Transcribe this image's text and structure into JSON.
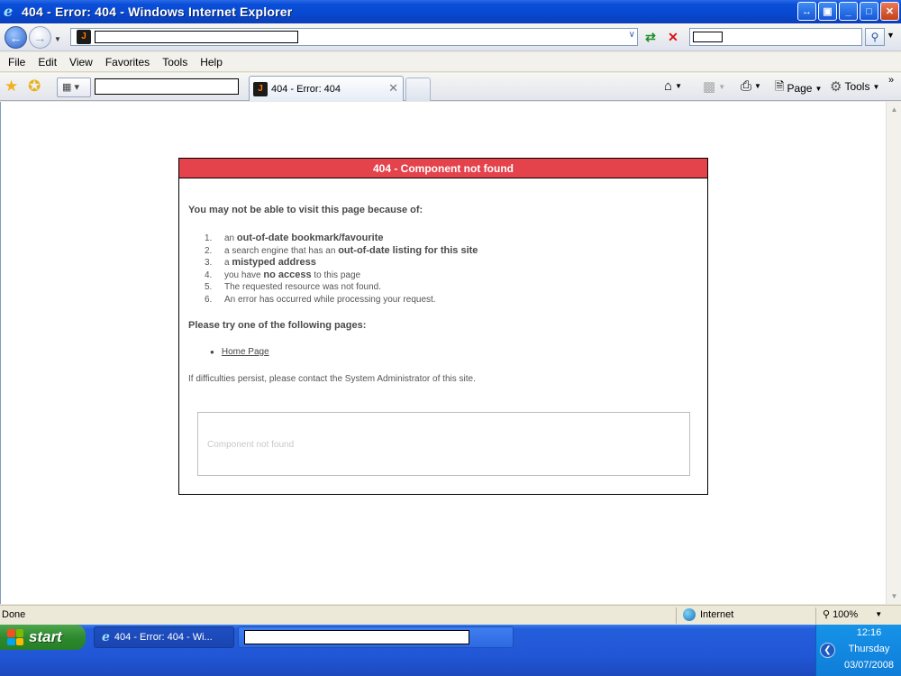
{
  "window": {
    "title": "404 - Error: 404 - Windows Internet Explorer"
  },
  "menu": [
    "File",
    "Edit",
    "View",
    "Favorites",
    "Tools",
    "Help"
  ],
  "tab": {
    "label": "404 - Error: 404"
  },
  "commands": {
    "page": "Page",
    "tools": "Tools"
  },
  "error_page": {
    "header": "404 - Component not found",
    "reasons_title": "You may not be able to visit this page because of:",
    "reasons": [
      {
        "num": "1.",
        "pre": "an ",
        "bold": "out-of-date bookmark/favourite",
        "post": ""
      },
      {
        "num": "2.",
        "pre": "a search engine that has an ",
        "bold": "out-of-date listing for this site",
        "post": ""
      },
      {
        "num": "3.",
        "pre": "a ",
        "bold": "mistyped address",
        "post": ""
      },
      {
        "num": "4.",
        "pre": "you have ",
        "bold": "no access",
        "post": " to this page"
      },
      {
        "num": "5.",
        "pre": "The requested resource was not found.",
        "bold": "",
        "post": ""
      },
      {
        "num": "6.",
        "pre": "An error has occurred while processing your request.",
        "bold": "",
        "post": ""
      }
    ],
    "try_title": "Please try one of the following pages:",
    "home_link": "Home Page",
    "persist": "If difficulties persist, please contact the System Administrator of this site.",
    "message": "Component not found"
  },
  "status": {
    "left": "Done",
    "zone": "Internet",
    "zoom": "100%"
  },
  "taskbar": {
    "start": "start",
    "item": "404 - Error: 404 - Wi...",
    "time": "12:16",
    "day": "Thursday",
    "date": "03/07/2008"
  }
}
